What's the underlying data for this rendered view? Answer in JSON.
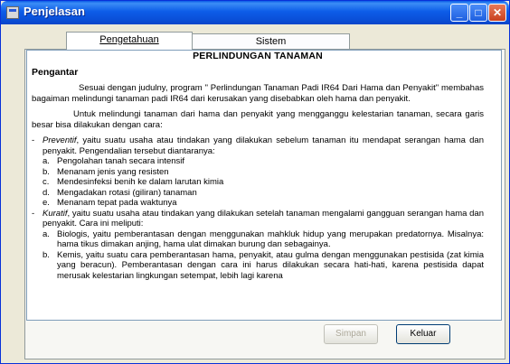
{
  "window": {
    "title": "Penjelasan",
    "buttons": [
      "minimize",
      "maximize",
      "close"
    ]
  },
  "tabs": [
    {
      "label": "Pengetahuan",
      "active": true
    },
    {
      "label": "Sistem",
      "active": false
    }
  ],
  "document": {
    "title": "PERLINDUNGAN TANAMAN",
    "section": "Pengantar",
    "p1": "Sesuai dengan judulny, program \" Perlindungan Tanaman Padi IR64 Dari Hama dan Penyakit\" membahas bagaiman melindungi tanaman padi IR64 dari kerusakan yang disebabkan oleh hama dan penyakit.",
    "p2": "Untuk melindungi tanaman dari hama dan penyakit yang mengganggu kelestarian tanaman, secara garis besar bisa dilakukan dengan cara:",
    "item1_term": "Preventif",
    "item1_text": ", yaitu suatu usaha atau tindakan yang dilakukan sebelum tanaman itu mendapat serangan hama dan penyakit. Pengendalian tersebut diantaranya:",
    "item1_subs": [
      {
        "letter": "a.",
        "text": "Pengolahan tanah secara intensif"
      },
      {
        "letter": "b.",
        "text": "Menanam jenis yang resisten"
      },
      {
        "letter": "c.",
        "text": "Mendesinfeksi benih ke dalam larutan kimia"
      },
      {
        "letter": "d.",
        "text": "Mengadakan rotasi (giliran) tanaman"
      },
      {
        "letter": "e.",
        "text": "Menanam tepat pada waktunya"
      }
    ],
    "item2_term": "Kuratif",
    "item2_text": ", yaitu suatu usaha atau tindakan yang dilakukan setelah tanaman mengalami gangguan serangan hama dan penyakit. Cara ini meliputi:",
    "item2_subs": [
      {
        "letter": "a.",
        "text": "Biologis, yaitu pemberantasan dengan menggunakan mahkluk hidup yang merupakan predatornya. Misalnya: hama tikus dimakan anjing, hama ulat dimakan burung dan sebagainya."
      },
      {
        "letter": "b.",
        "text": "Kemis, yaitu suatu cara pemberantasan hama, penyakit, atau gulma dengan menggunakan pestisida (zat kimia yang beracun). Pemberantasan dengan cara ini harus dilakukan secara hati-hati, karena pestisida dapat merusak kelestarian lingkungan setempat, lebih lagi karena"
      }
    ]
  },
  "buttons": {
    "save": "Simpan",
    "exit": "Keluar"
  }
}
